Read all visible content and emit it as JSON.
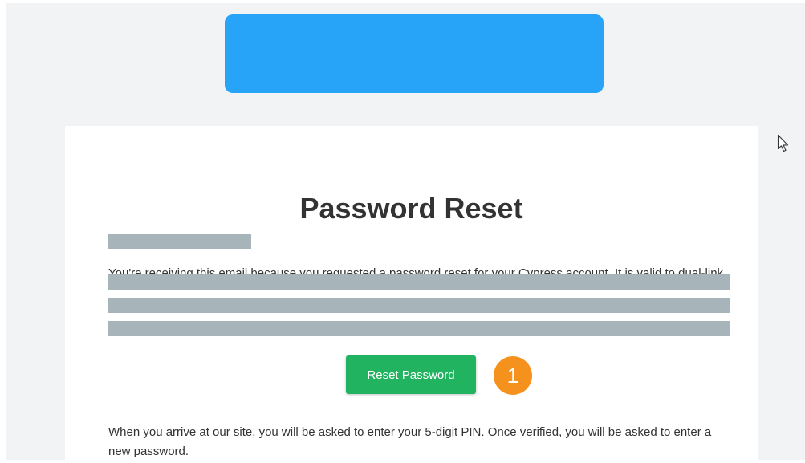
{
  "colors": {
    "header_banner": "#27a3f7",
    "redaction": "#a7b4b9",
    "button_bg": "#21b35f",
    "badge_bg": "#f5921e"
  },
  "email": {
    "title": "Password Reset",
    "partial_line": "You're receiving this email because you requested a password reset for your Cypress account. It is valid to dual-link.",
    "reset_button_label": "Reset Password",
    "instructions": "When you arrive at our site, you will be asked to enter your 5-digit PIN. Once verified, you will be asked to enter a new password."
  },
  "annotation": {
    "step_number": "1"
  },
  "icons": {
    "cursor": "mouse-pointer-icon"
  }
}
